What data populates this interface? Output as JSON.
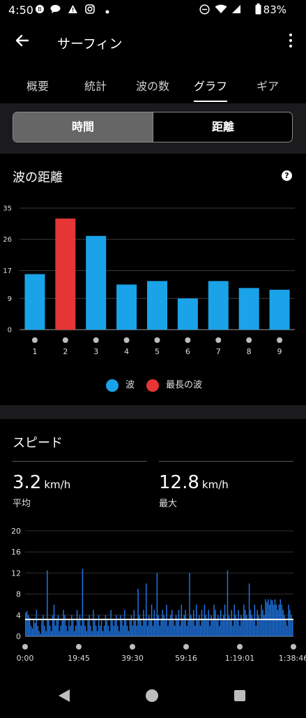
{
  "status": {
    "time": "4:50",
    "battery": "83%",
    "icons": [
      "sync-icon",
      "chat-icon",
      "warning-icon",
      "instagram-icon",
      "dot-icon",
      "dnd-icon",
      "wifi-icon",
      "signal-icon",
      "battery-icon"
    ]
  },
  "header": {
    "title": "サーフィン"
  },
  "tabs": [
    {
      "label": "概要"
    },
    {
      "label": "統計"
    },
    {
      "label": "波の数"
    },
    {
      "label": "グラフ"
    },
    {
      "label": "ギア"
    }
  ],
  "active_tab": "グラフ",
  "segment": {
    "time": "時間",
    "distance": "距離",
    "selected": "時間"
  },
  "distance_card": {
    "title": "波の距離",
    "help": "?",
    "legend": {
      "wave": "波",
      "longest": "最長の波"
    }
  },
  "speed_card": {
    "title": "スピード",
    "avg_value": "3.2",
    "avg_unit": "km/h",
    "avg_label": "平均",
    "max_value": "12.8",
    "max_unit": "km/h",
    "max_label": "最大"
  },
  "colors": {
    "wave": "#1aa3e8",
    "longest": "#e53535",
    "speed_fill": "#1f77e6",
    "avg_line": "#ffffff"
  },
  "chart_data": [
    {
      "type": "bar",
      "title": "波の距離",
      "categories": [
        "1",
        "2",
        "3",
        "4",
        "5",
        "6",
        "7",
        "8",
        "9"
      ],
      "series": [
        {
          "name": "波",
          "values": [
            16,
            32,
            27,
            13,
            14,
            9,
            14,
            12,
            11.5
          ]
        }
      ],
      "highlight_index": 1,
      "highlight_series_name": "最長の波",
      "ylim": [
        0,
        35
      ],
      "yticks": [
        0,
        9,
        17,
        26,
        35
      ],
      "grid": true,
      "legend": "bottom-center"
    },
    {
      "type": "area",
      "title": "スピード",
      "xtick_labels": [
        "0:00",
        "19:45",
        "39:30",
        "59:16",
        "1:19:01",
        "1:38:46"
      ],
      "yticks": [
        0,
        4,
        8,
        12,
        16,
        20
      ],
      "ylim": [
        0,
        20
      ],
      "average": 3.2,
      "max": 12.8,
      "grid": true,
      "series": [
        {
          "values": [
            4.5,
            4.8,
            4,
            3.5,
            2,
            1.5,
            3,
            2.5,
            5,
            2,
            1,
            0.5,
            3,
            4,
            2,
            1,
            12.5,
            3,
            2,
            1,
            4,
            6,
            2,
            3,
            4,
            1,
            2,
            3,
            5,
            4,
            2,
            1,
            3,
            2,
            4,
            3,
            1,
            2,
            5,
            3,
            4,
            2,
            12.8,
            3,
            2,
            1,
            3,
            4,
            2,
            1,
            5,
            3,
            2,
            1,
            4,
            2,
            3,
            1,
            2,
            4,
            3,
            2,
            1,
            5,
            3,
            2,
            3,
            4,
            2,
            1,
            4,
            3,
            2,
            5,
            3,
            2,
            1,
            3,
            4,
            2,
            5,
            3,
            2,
            9,
            4,
            3,
            2,
            5,
            3,
            10,
            2,
            4,
            3,
            6,
            2,
            5,
            3,
            12,
            4,
            2,
            3,
            5,
            4,
            3,
            6,
            2,
            3,
            4,
            5,
            3,
            2,
            4,
            3,
            5,
            2,
            6,
            3,
            4,
            5,
            2,
            3,
            12,
            4,
            3,
            5,
            2,
            6,
            3,
            4,
            2,
            5,
            3,
            6,
            4,
            3,
            5,
            2,
            4,
            3,
            6,
            5,
            3,
            4,
            2,
            5,
            3,
            4,
            6,
            3,
            12.5,
            4,
            3,
            5,
            2,
            6,
            4,
            3,
            5,
            2,
            4,
            3,
            6,
            5,
            4,
            3,
            10,
            5,
            4,
            3,
            6,
            2,
            5,
            4,
            3,
            6,
            5,
            4,
            7,
            6.5,
            7,
            6,
            7,
            6.8,
            6,
            7,
            6,
            5,
            6,
            7,
            6,
            5,
            4,
            3,
            2,
            6,
            5,
            4,
            3
          ]
        }
      ]
    }
  ]
}
